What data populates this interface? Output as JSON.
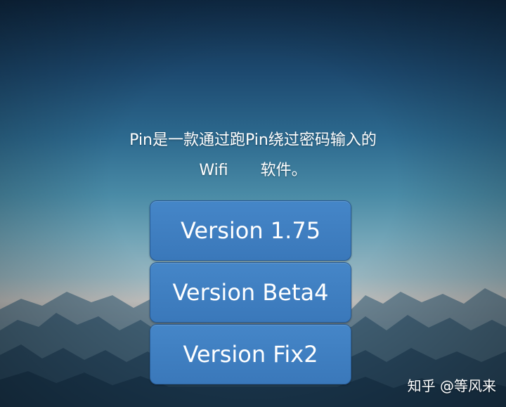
{
  "description": {
    "line1": "Pin是一款通过跑Pin绕过密码输入的",
    "line2_left": "Wifi",
    "line2_right": "软件。"
  },
  "versions": [
    {
      "label": "Version 1.75"
    },
    {
      "label": "Version Beta4"
    },
    {
      "label": "Version Fix2"
    }
  ],
  "watermark": "知乎 @等风来",
  "colors": {
    "button": "#3f80c2",
    "sky_top": "#0f2a45",
    "horizon": "#c3c3c1"
  }
}
